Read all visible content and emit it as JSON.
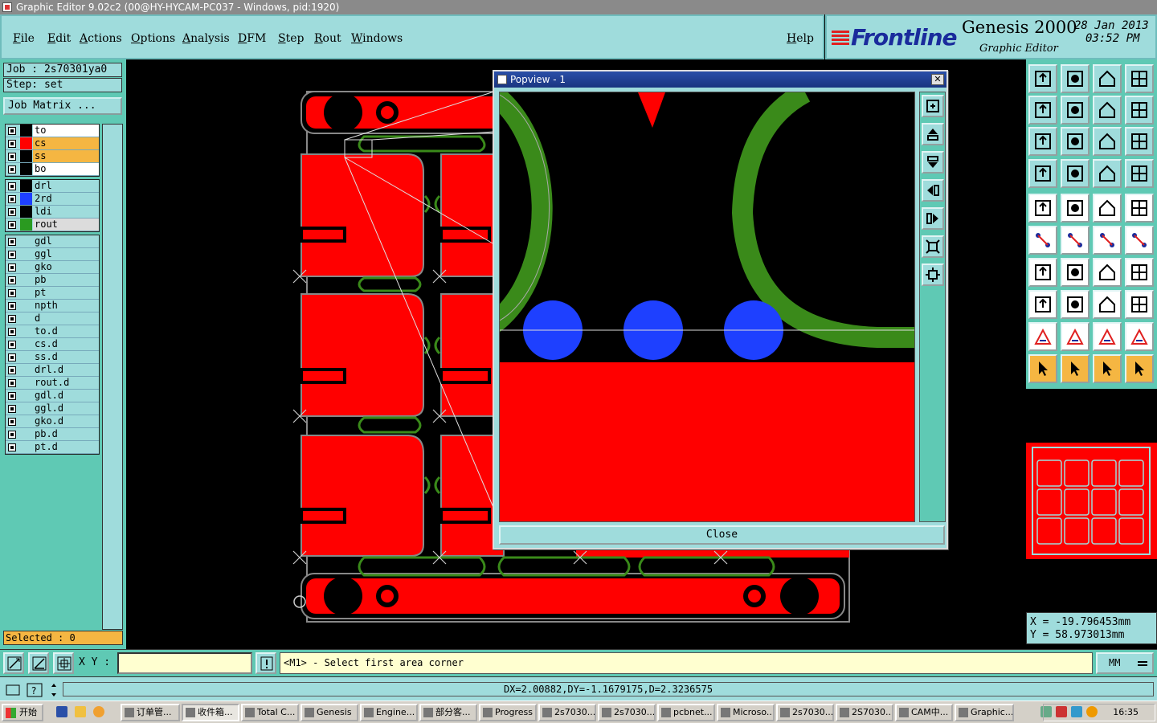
{
  "window": {
    "title": "Graphic Editor 9.02c2 (00@HY-HYCAM-PC037 - Windows, pid:1920)"
  },
  "menu": {
    "items": [
      "File",
      "Edit",
      "Actions",
      "Options",
      "Analysis",
      "DFM",
      "Step",
      "Rout",
      "Windows"
    ],
    "help": "Help"
  },
  "brand": {
    "logo": "Frontline",
    "product": "Genesis 2000",
    "subtitle": "Graphic Editor",
    "date": "28 Jan 2013",
    "time": "03:52 PM"
  },
  "job": {
    "job_line": "Job : 2s70301ya0",
    "step_line": "Step: set",
    "matrix_button": "Job Matrix ..."
  },
  "layers": {
    "board": [
      {
        "name": "to",
        "swatch": "#000000",
        "bg": "#ffffff"
      },
      {
        "name": "cs",
        "swatch": "#ff0000",
        "bg": "#f5b642"
      },
      {
        "name": "ss",
        "swatch": "#000000",
        "bg": "#f5b642"
      },
      {
        "name": "bo",
        "swatch": "#000000",
        "bg": "#ffffff"
      }
    ],
    "drill": [
      {
        "name": "drl",
        "swatch": "#000000",
        "bg": "#9fdcdc"
      },
      {
        "name": "2rd",
        "swatch": "#1e40ff",
        "bg": "#9fdcdc"
      },
      {
        "name": "ldi",
        "swatch": "#000000",
        "bg": "#9fdcdc"
      },
      {
        "name": "rout",
        "swatch": "#2a9a20",
        "bg": "#dcdcdc"
      }
    ],
    "misc": [
      {
        "name": "gdl"
      },
      {
        "name": "ggl"
      },
      {
        "name": "gko"
      },
      {
        "name": "pb"
      },
      {
        "name": "pt"
      },
      {
        "name": "npth"
      },
      {
        "name": "d"
      },
      {
        "name": "to.d"
      },
      {
        "name": "cs.d"
      },
      {
        "name": "ss.d"
      },
      {
        "name": "drl.d"
      },
      {
        "name": "rout.d"
      },
      {
        "name": "gdl.d"
      },
      {
        "name": "ggl.d"
      },
      {
        "name": "gko.d"
      },
      {
        "name": "pb.d"
      },
      {
        "name": "pt.d"
      }
    ],
    "selected": "Selected : 0"
  },
  "popview": {
    "title": "Popview - 1",
    "close_button": "Close"
  },
  "coords": {
    "x": "X  = -19.796453mm",
    "y": "Y  =  58.973013mm"
  },
  "command": {
    "xy_label": "X Y :",
    "xy_value": "",
    "prompt": "<M1> - Select first area corner",
    "units": "MM"
  },
  "status": {
    "text": "DX=2.00882,DY=-1.1679175,D=2.3236575"
  },
  "taskbar": {
    "start": "开始",
    "tasks": [
      "订单管...",
      "收件箱...",
      "Total C...",
      "Genesis",
      "Engine...",
      "部分客...",
      "Progress",
      "2s7030...",
      "2s7030...",
      "pcbnet...",
      "Microso...",
      "2s7030...",
      "2S7030...",
      "CAM中...",
      "Graphic..."
    ],
    "active_index": 1,
    "clock": "16:35"
  },
  "colors": {
    "copper": "#ff0000",
    "rout": "#3a8a1a",
    "drill": "#1e40ff",
    "panel": "#9fdcdc",
    "panel_dark": "#5fc9b4",
    "highlight": "#f5b642"
  }
}
